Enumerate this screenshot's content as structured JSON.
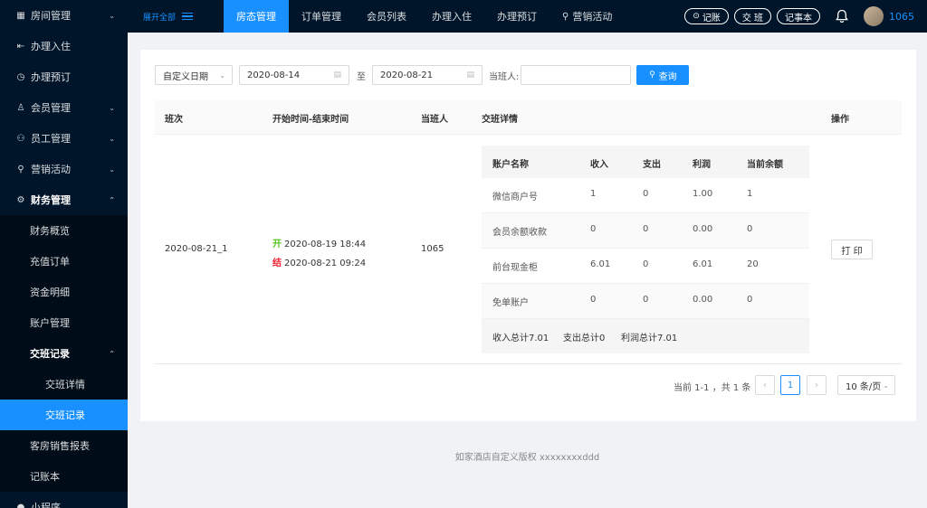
{
  "sidebar": {
    "items": [
      {
        "label": "房间管理",
        "icon": "grid-icon",
        "arrow": "down"
      },
      {
        "label": "办理入住",
        "icon": "checkin-icon"
      },
      {
        "label": "办理预订",
        "icon": "clock-icon"
      },
      {
        "label": "会员管理",
        "icon": "user-icon",
        "arrow": "down"
      },
      {
        "label": "员工管理",
        "icon": "staff-icon",
        "arrow": "down"
      },
      {
        "label": "营销活动",
        "icon": "org-icon",
        "arrow": "down"
      },
      {
        "label": "财务管理",
        "icon": "gear-icon",
        "arrow": "up"
      }
    ],
    "finance_sub": [
      "财务概览",
      "充值订单",
      "资金明细",
      "账户管理"
    ],
    "shift_group": "交班记录",
    "shift_sub": [
      "交班详情",
      "交班记录"
    ],
    "finance_sub2": [
      "客房销售报表",
      "记账本"
    ],
    "bottom_item": "小程序"
  },
  "header": {
    "expand_label": "展开全部",
    "tabs": [
      "房态管理",
      "订单管理",
      "会员列表",
      "办理入住",
      "办理预订",
      "营销活动"
    ],
    "pills": [
      "记账",
      "交 班",
      "记事本"
    ],
    "user": "1065"
  },
  "filters": {
    "date_type": "自定义日期",
    "start_date": "2020-08-14",
    "sep": "至",
    "end_date": "2020-08-21",
    "operator_label": "当班人:",
    "search_label": "查询"
  },
  "table": {
    "headers": [
      "班次",
      "开始时间-结束时间",
      "当班人",
      "交班详情",
      "操作"
    ],
    "row": {
      "shift": "2020-08-21_1",
      "open_tag": "开",
      "start": "2020-08-19 18:44",
      "close_tag": "结",
      "end": "2020-08-21 09:24",
      "operator": "1065",
      "action": "打 印"
    },
    "detail": {
      "headers": [
        "账户名称",
        "收入",
        "支出",
        "利润",
        "当前余额"
      ],
      "rows": [
        [
          "微信商户号",
          "1",
          "0",
          "1.00",
          "1"
        ],
        [
          "会员余额收款",
          "0",
          "0",
          "0.00",
          "0"
        ],
        [
          "前台现金柜",
          "6.01",
          "0",
          "6.01",
          "20"
        ],
        [
          "免单账户",
          "0",
          "0",
          "0.00",
          "0"
        ]
      ],
      "totals": [
        "收入总计7.01",
        "支出总计0",
        "利润总计7.01"
      ]
    }
  },
  "pager": {
    "total": "当前 1-1 ，共 1 条",
    "current": "1",
    "size": "10 条/页"
  },
  "footer": "如家酒店自定义版权 xxxxxxxxddd",
  "colors": {
    "primary": "#1890ff",
    "sider": "#001529",
    "open": "#52c41a",
    "close": "#f5222d"
  }
}
